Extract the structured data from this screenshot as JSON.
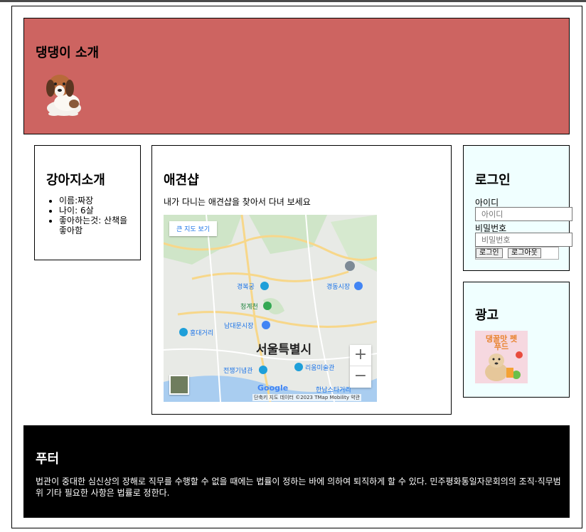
{
  "header": {
    "title": "댕댕이 소개"
  },
  "intro": {
    "title": "강아지소개",
    "items": [
      "이름:짜장",
      "나이: 6살",
      "좋아하는것: 산책을 좋아함"
    ]
  },
  "shop": {
    "title": "애견샵",
    "desc": "내가 다니는 애견샵을 찾아서 다녀 보세요",
    "map": {
      "big_map_label": "큰 지도 보기",
      "city_label": "서울특별시",
      "logo": "Google",
      "attribution": "단축키  지도 데이터 ©2023 TMap Mobility  약관",
      "zoom_in": "+",
      "zoom_out": "−",
      "places": [
        "경복궁",
        "청계천",
        "남대문시장",
        "홍대거리",
        "전쟁기념관",
        "리움미술관",
        "경동시장",
        "한남스타거리"
      ]
    }
  },
  "login": {
    "title": "로그인",
    "id_label": "아이디",
    "id_placeholder": "아이디",
    "pw_label": "비밀번호",
    "pw_placeholder": "비밀번호",
    "login_btn": "로그인",
    "logout_btn": "로그아웃"
  },
  "ad": {
    "title": "광고",
    "image_text": "댕꿀맛 펫푸드"
  },
  "footer": {
    "title": "푸터",
    "text": "법관이 중대한 심신상의 장해로 직무를 수행할 수 없을 때에는 법률이 정하는 바에 의하여 퇴직하게 할 수 있다. 민주평화통일자문회의의 조직·직무범위 기타 필요한 사항은 법률로 정한다."
  },
  "colors": {
    "header_bg": "#cd6461",
    "sidebar_bg": "#f0ffff",
    "footer_bg": "#000000"
  }
}
